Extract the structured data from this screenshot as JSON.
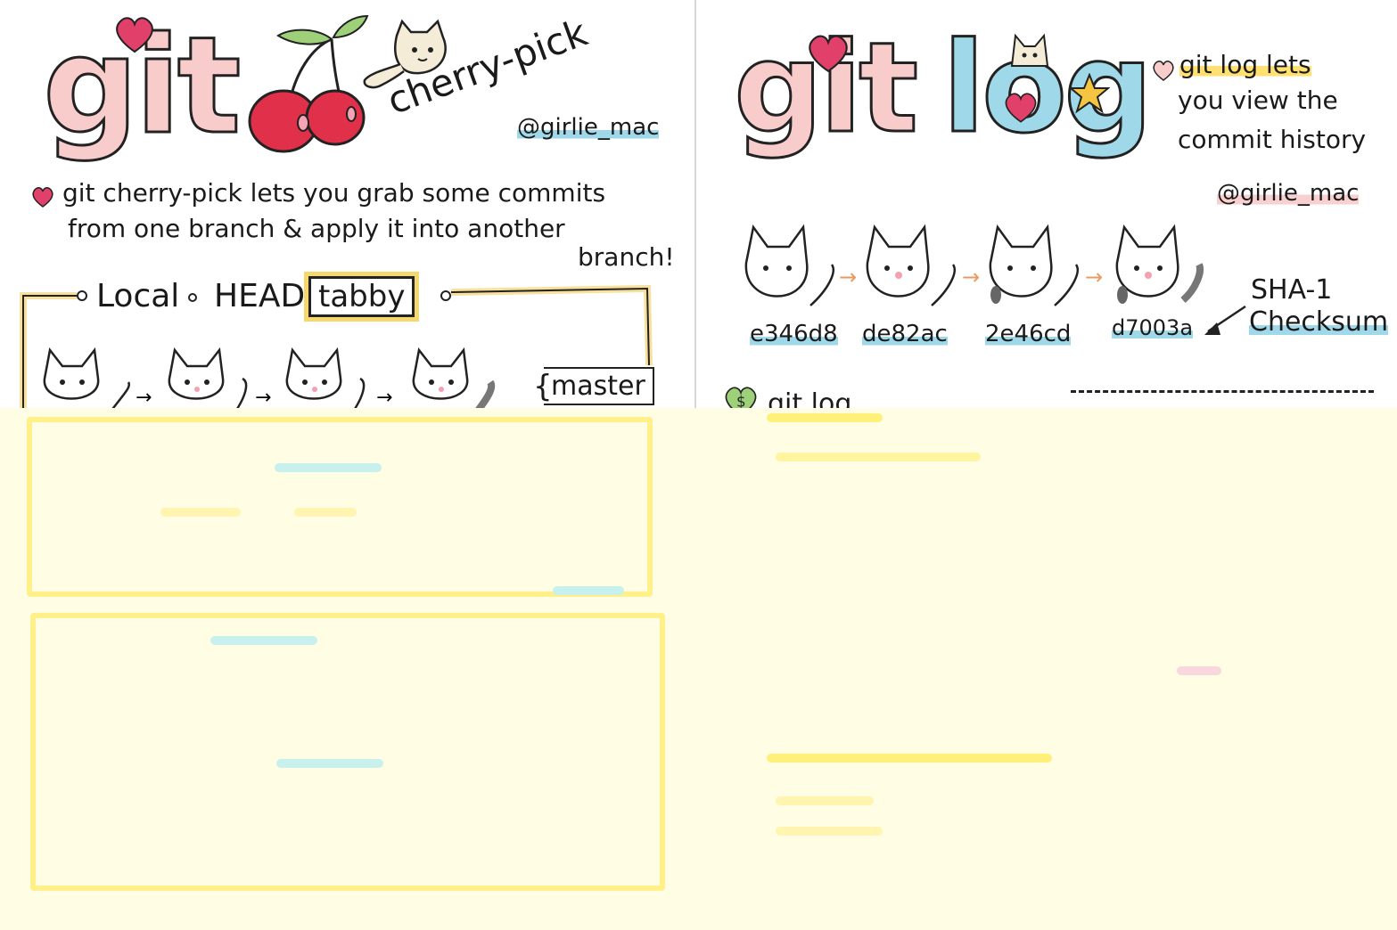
{
  "left": {
    "title": "git",
    "subtitle": "cherry-pick",
    "handle": "@girlie_mac",
    "description_lines": [
      "git cherry-pick lets you grab some commits",
      "from one branch & apply it into another",
      "branch!"
    ],
    "diagram": {
      "local_label": "Local",
      "head_label": "HEAD",
      "branch_tag": "tabby",
      "master_label": "master"
    }
  },
  "right": {
    "title_git": "git",
    "title_log": "log",
    "description_lines": [
      "git log lets",
      "you view the",
      "commit history"
    ],
    "handle": "@girlie_mac",
    "commits": [
      "e346d8",
      "de82ac",
      "2e46cd",
      "d7003a"
    ],
    "checksum_lines": [
      "SHA-1",
      "Checksum"
    ],
    "command_partial": "git log"
  },
  "colors": {
    "title_fill": "#f9cccc",
    "log_fill": "#9fd8e8",
    "heart": "#e0406a",
    "cherry": "#e0304a",
    "highlight_yellow": "#ffe070",
    "highlight_blue": "#9fd8e8",
    "wash": "#fffde3"
  }
}
